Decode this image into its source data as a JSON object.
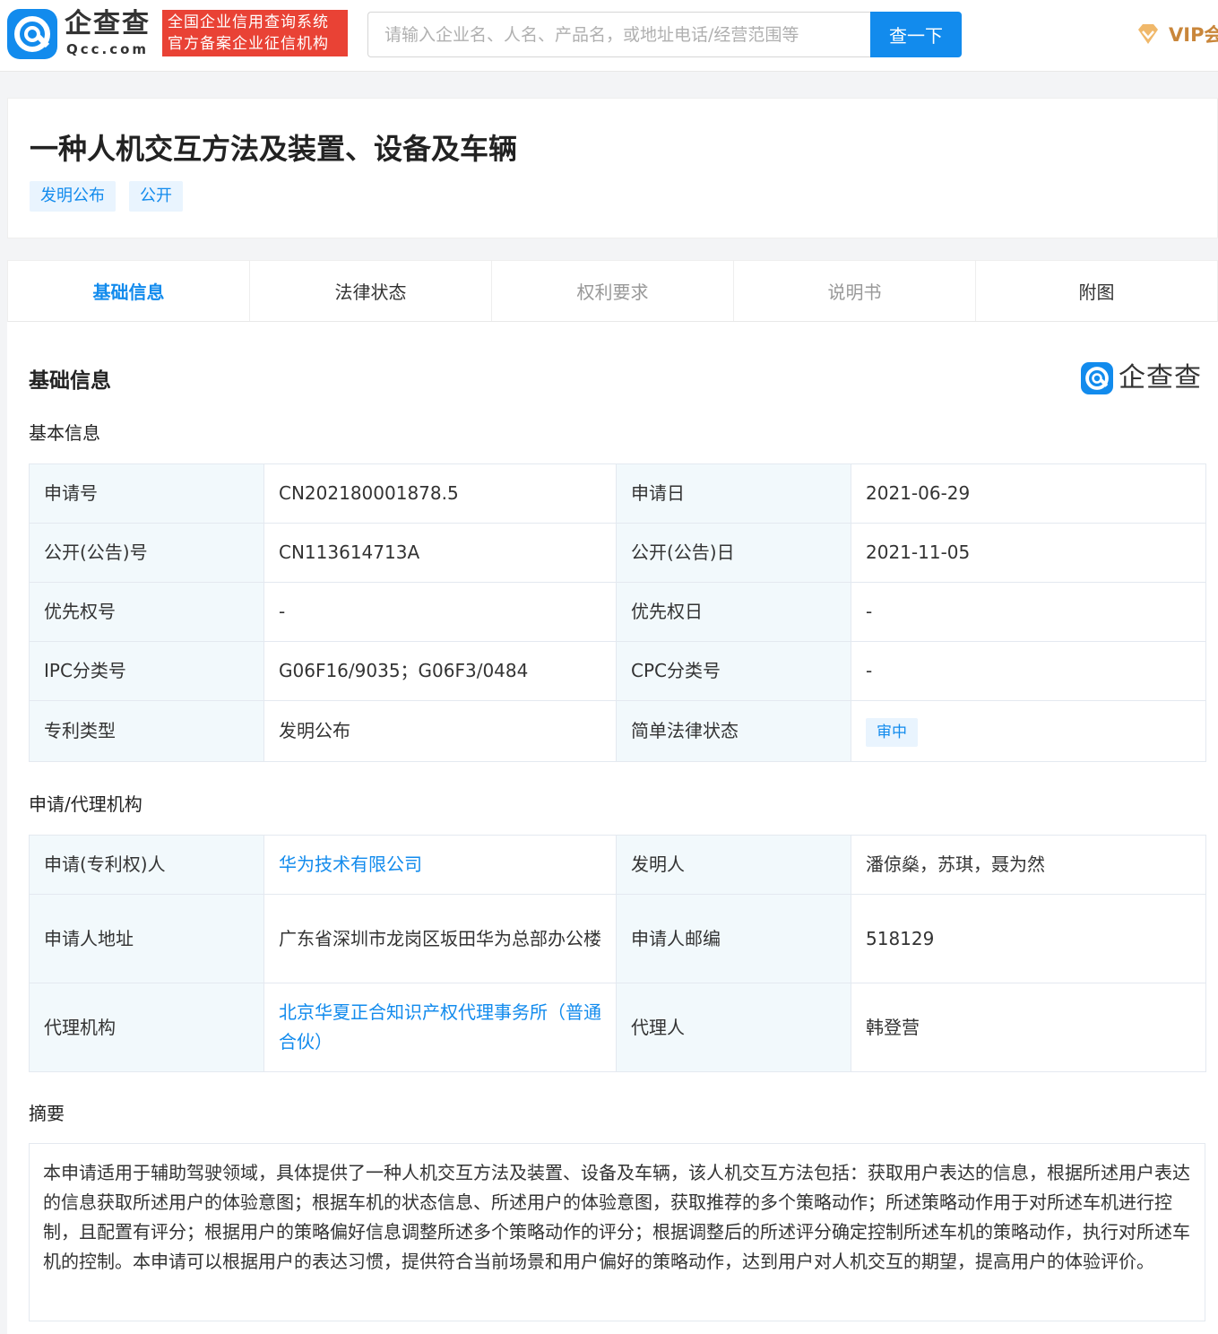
{
  "header": {
    "logo_text": "企查查",
    "logo_domain": "Qcc.com",
    "badge_line1": "全国企业信用查询系统",
    "badge_line2": "官方备案企业征信机构",
    "search_placeholder": "请输入企业名、人名、产品名，或地址电话/经营范围等",
    "search_button": "查一下",
    "vip_label": "VIP会"
  },
  "patent": {
    "title": "一种人机交互方法及装置、设备及车辆",
    "tags": [
      "发明公布",
      "公开"
    ]
  },
  "tabs": [
    {
      "label": "基础信息",
      "state": "active"
    },
    {
      "label": "法律状态",
      "state": "normal"
    },
    {
      "label": "权利要求",
      "state": "muted"
    },
    {
      "label": "说明书",
      "state": "muted"
    },
    {
      "label": "附图",
      "state": "normal"
    }
  ],
  "section": {
    "title": "基础信息",
    "watermark": "企查查"
  },
  "basic_info": {
    "title": "基本信息",
    "rows": [
      {
        "label1": "申请号",
        "value1": "CN202180001878.5",
        "label2": "申请日",
        "value2": "2021-06-29"
      },
      {
        "label1": "公开(公告)号",
        "value1": "CN113614713A",
        "label2": "公开(公告)日",
        "value2": "2021-11-05"
      },
      {
        "label1": "优先权号",
        "value1": "-",
        "label2": "优先权日",
        "value2": "-"
      },
      {
        "label1": "IPC分类号",
        "value1": "G06F16/9035；G06F3/0484",
        "label2": "CPC分类号",
        "value2": "-"
      },
      {
        "label1": "专利类型",
        "value1": "发明公布",
        "label2": "简单法律状态",
        "value2": "审中"
      }
    ]
  },
  "agency": {
    "title": "申请/代理机构",
    "rows": [
      {
        "label1": "申请(专利权)人",
        "value1": "华为技术有限公司",
        "label2": "发明人",
        "value2": "潘倞燊，苏琪，聂为然"
      },
      {
        "label1": "申请人地址",
        "value1": "广东省深圳市龙岗区坂田华为总部办公楼",
        "label2": "申请人邮编",
        "value2": "518129"
      },
      {
        "label1": "代理机构",
        "value1": "北京华夏正合知识产权代理事务所（普通合伙）",
        "label2": "代理人",
        "value2": "韩登营"
      }
    ]
  },
  "abstract": {
    "title": "摘要",
    "text": "本申请适用于辅助驾驶领域，具体提供了一种人机交互方法及装置、设备及车辆，该人机交互方法包括：获取用户表达的信息，根据所述用户表达的信息获取所述用户的体验意图；根据车机的状态信息、所述用户的体验意图，获取推荐的多个策略动作；所述策略动作用于对所述车机进行控制，且配置有评分；根据用户的策略偏好信息调整所述多个策略动作的评分；根据调整后的所述评分确定控制所述车机的策略动作，执行对所述车机的控制。本申请可以根据用户的表达习惯，提供符合当前场景和用户偏好的策略动作，达到用户对人机交互的期望，提高用户的体验评价。"
  },
  "colors": {
    "brand": "#128bed",
    "badge_red": "#e94235",
    "vip_gold": "#c9863a",
    "label_bg": "#f2f9fc"
  }
}
